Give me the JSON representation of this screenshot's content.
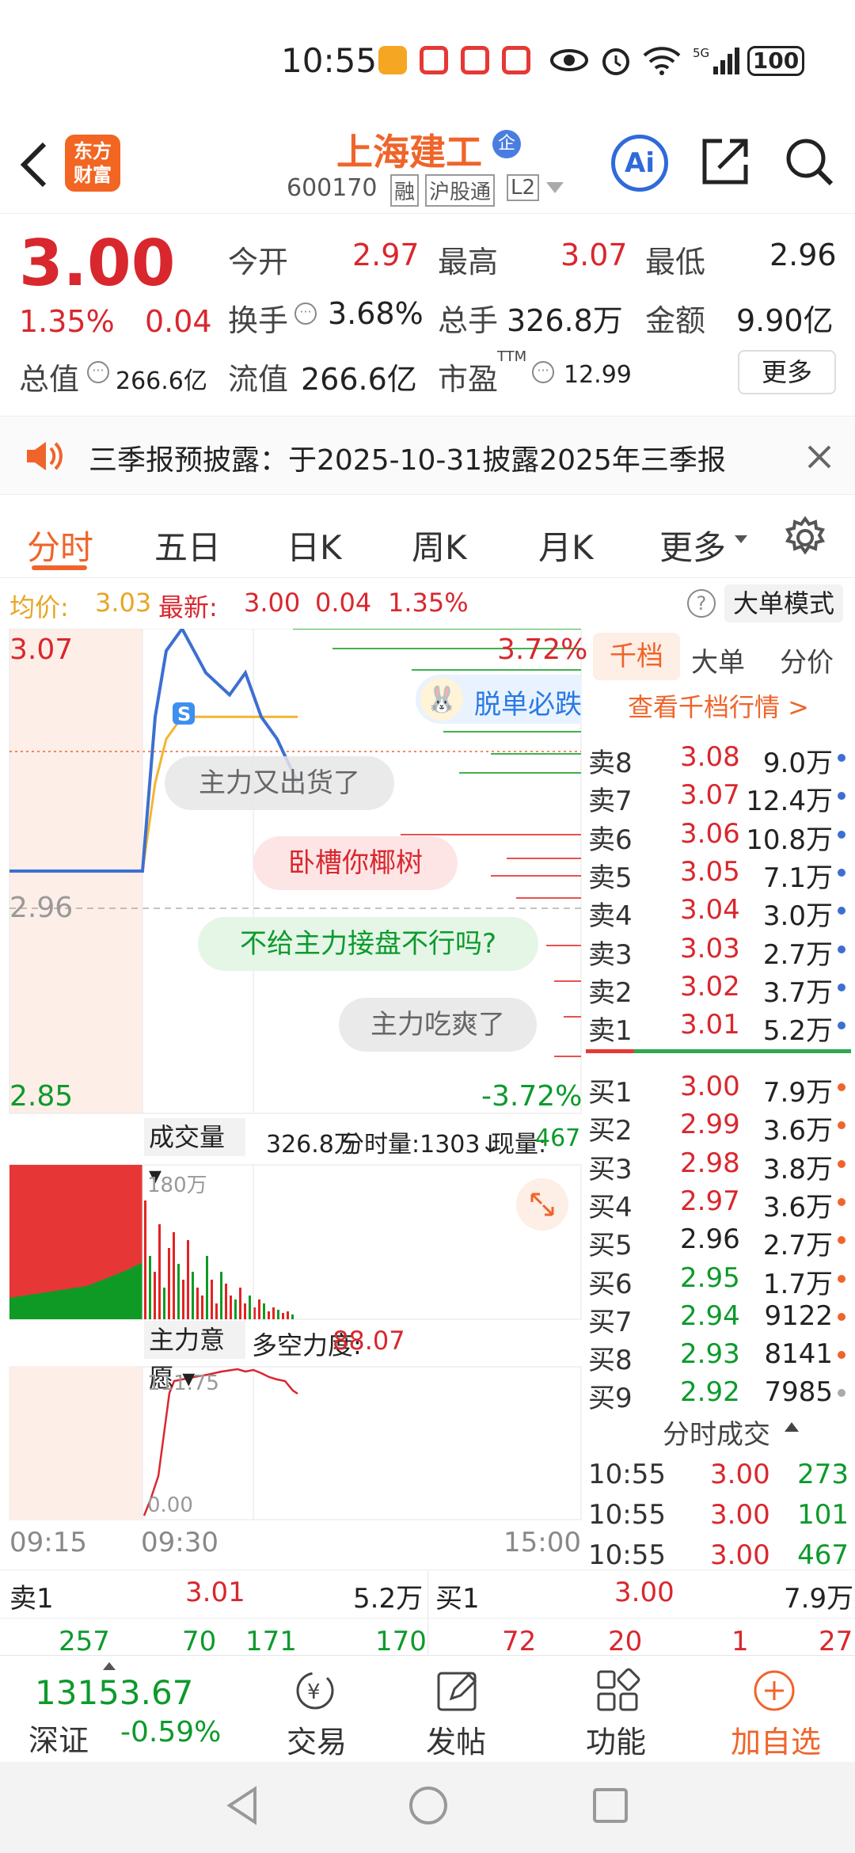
{
  "status": {
    "time": "10:55",
    "battery": "100"
  },
  "header": {
    "logo_top": "东方",
    "logo_bottom": "财富",
    "title": "上海建工",
    "code": "600170",
    "tags": [
      "融",
      "沪股通",
      "L2"
    ],
    "ai_label": "Ai"
  },
  "quote": {
    "price": "3.00",
    "pct": "1.35%",
    "chg": "0.04",
    "open_label": "今开",
    "open": "2.97",
    "high_label": "最高",
    "high": "3.07",
    "low_label": "最低",
    "low": "2.96",
    "turnover_label": "换手",
    "turnover": "3.68%",
    "volume_label": "总手",
    "volume": "326.8万",
    "amount_label": "金额",
    "amount": "9.90亿",
    "mktcap_label": "总值",
    "mktcap": "266.6亿",
    "float_label": "流值",
    "float": "266.6亿",
    "pe_label": "市盈",
    "pe_sup": "TTM",
    "pe": "12.99",
    "more": "更多"
  },
  "notice": {
    "text": "三季报预披露：于2025-10-31披露2025年三季报"
  },
  "tabs": [
    "分时",
    "五日",
    "日K",
    "周K",
    "月K",
    "更多"
  ],
  "chart": {
    "avg_label": "均价:",
    "avg": "3.03",
    "last_label": "最新:",
    "last": "3.00",
    "chg": "0.04",
    "pct": "1.35%",
    "mode": "大单模式",
    "y_top": "3.07",
    "y_mid": "2.96",
    "y_bottom": "2.85",
    "pct_top": "3.72%",
    "pct_bottom": "-3.72%",
    "promo": "脱单必跌",
    "danmu": [
      "主力又出货了",
      "卧槽你椰树",
      "不给主力接盘不行吗?",
      "主力吃爽了"
    ],
    "vol_label": "成交量",
    "vol_total": "326.8万",
    "tick_label": "分时量:1303↓",
    "now_label": "现量:",
    "now_val": "467",
    "vol_max": "180万",
    "intent_label": "主力意愿",
    "force_label": "多空力度:",
    "force_val": "88.07",
    "intent_max": "111.75",
    "intent_min": "0.00",
    "x_labels": [
      "09:15",
      "09:30",
      "15:00"
    ]
  },
  "chart_data": {
    "type": "line",
    "title": "",
    "x": [
      "09:15",
      "09:30",
      "15:00"
    ],
    "ylim": [
      2.85,
      3.07
    ],
    "prev_close": 2.96,
    "series": [
      {
        "name": "",
        "values": [
          2.96,
          2.96,
          2.96,
          3.03,
          3.06,
          3.07,
          3.05,
          3.04,
          3.05,
          3.03,
          3.02,
          3.0
        ]
      },
      {
        "name": "均价",
        "values": [
          2.96,
          2.96,
          2.96,
          3.0,
          3.02,
          3.03,
          3.03,
          3.03,
          3.03,
          3.03,
          3.03,
          3.03
        ]
      }
    ]
  },
  "book": {
    "tabs": [
      "千档",
      "大单",
      "分价"
    ],
    "link": "查看千档行情 >",
    "asks": [
      [
        "卖8",
        "3.08",
        "9.0万"
      ],
      [
        "卖7",
        "3.07",
        "12.4万"
      ],
      [
        "卖6",
        "3.06",
        "10.8万"
      ],
      [
        "卖5",
        "3.05",
        "7.1万"
      ],
      [
        "卖4",
        "3.04",
        "3.0万"
      ],
      [
        "卖3",
        "3.03",
        "2.7万"
      ],
      [
        "卖2",
        "3.02",
        "3.7万"
      ],
      [
        "卖1",
        "3.01",
        "5.2万"
      ]
    ],
    "bids": [
      [
        "买1",
        "3.00",
        "7.9万"
      ],
      [
        "买2",
        "2.99",
        "3.6万"
      ],
      [
        "买3",
        "2.98",
        "3.8万"
      ],
      [
        "买4",
        "2.97",
        "3.6万"
      ],
      [
        "买5",
        "2.96",
        "2.7万"
      ],
      [
        "买6",
        "2.95",
        "1.7万"
      ],
      [
        "买7",
        "2.94",
        "9122"
      ],
      [
        "买8",
        "2.93",
        "8141"
      ],
      [
        "买9",
        "2.92",
        "7985"
      ]
    ],
    "trades_label": "分时成交",
    "trades": [
      [
        "10:55",
        "3.00",
        "273"
      ],
      [
        "10:55",
        "3.00",
        "101"
      ],
      [
        "10:55",
        "3.00",
        "467"
      ]
    ]
  },
  "bottom": {
    "sell_label": "卖1",
    "sell_price": "3.01",
    "sell_vol": "5.2万",
    "buy_label": "买1",
    "buy_price": "3.00",
    "buy_vol": "7.9万",
    "left_nums": [
      "257",
      "70",
      "171",
      "170"
    ],
    "right_nums": [
      "72",
      "20",
      "1",
      "27"
    ]
  },
  "nav": {
    "index_val": "13153.67",
    "index_name": "深证",
    "index_pct": "-0.59%",
    "items": [
      "交易",
      "发帖",
      "功能",
      "加自选"
    ]
  }
}
